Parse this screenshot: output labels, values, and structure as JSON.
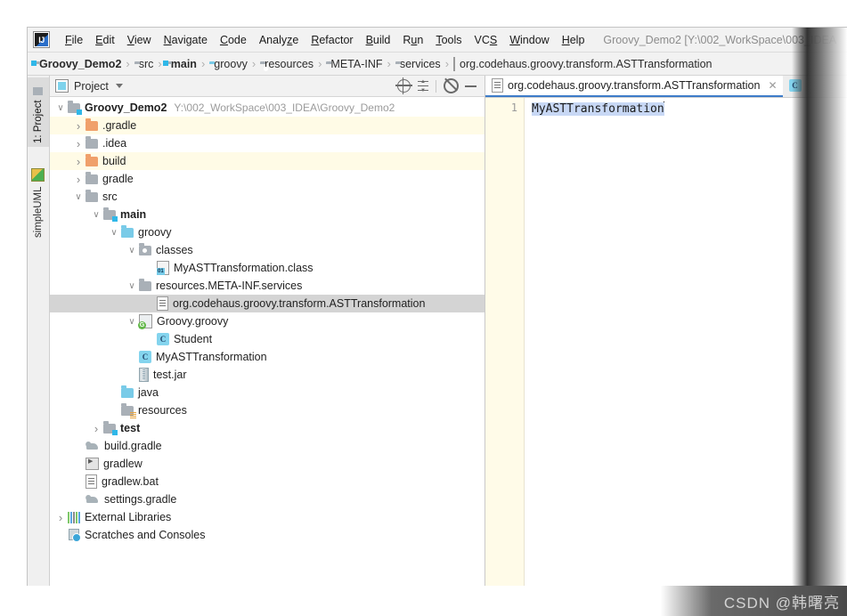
{
  "window": {
    "logo_icon": "intellij-logo-icon",
    "title": "Groovy_Demo2 [Y:\\002_WorkSpace\\003_IDEA"
  },
  "menubar": {
    "items": [
      {
        "pre": "",
        "mn": "F",
        "post": "ile"
      },
      {
        "pre": "",
        "mn": "E",
        "post": "dit"
      },
      {
        "pre": "",
        "mn": "V",
        "post": "iew"
      },
      {
        "pre": "",
        "mn": "N",
        "post": "avigate"
      },
      {
        "pre": "",
        "mn": "C",
        "post": "ode"
      },
      {
        "pre": "Analy",
        "mn": "z",
        "post": "e"
      },
      {
        "pre": "",
        "mn": "R",
        "post": "efactor"
      },
      {
        "pre": "",
        "mn": "B",
        "post": "uild"
      },
      {
        "pre": "R",
        "mn": "u",
        "post": "n"
      },
      {
        "pre": "",
        "mn": "T",
        "post": "ools"
      },
      {
        "pre": "VC",
        "mn": "S",
        "post": ""
      },
      {
        "pre": "",
        "mn": "W",
        "post": "indow"
      },
      {
        "pre": "",
        "mn": "H",
        "post": "elp"
      }
    ]
  },
  "breadcrumb": {
    "items": [
      {
        "label": "Groovy_Demo2",
        "icon": "module-folder-icon",
        "bold": true
      },
      {
        "label": "src",
        "icon": "folder-icon",
        "bold": false
      },
      {
        "label": "main",
        "icon": "module-folder-icon",
        "bold": true
      },
      {
        "label": "groovy",
        "icon": "source-folder-icon",
        "bold": false
      },
      {
        "label": "resources",
        "icon": "resource-folder-icon",
        "bold": false
      },
      {
        "label": "META-INF",
        "icon": "folder-icon",
        "bold": false
      },
      {
        "label": "services",
        "icon": "folder-icon",
        "bold": false
      },
      {
        "label": "org.codehaus.groovy.transform.ASTTransformation",
        "icon": "file-icon",
        "bold": false
      }
    ],
    "separator": "›"
  },
  "toolstrip": {
    "tabs": [
      {
        "label": "1: Project",
        "icon": "project-folder-icon",
        "active": true
      },
      {
        "label": "simpleUML",
        "icon": "uml-icon",
        "active": false
      }
    ]
  },
  "project_panel": {
    "title": "Project",
    "icon": "project-view-icon",
    "dropdown_icon": "chevron-down-icon",
    "actions": [
      {
        "name": "locate-icon",
        "title": "Select Opened File"
      },
      {
        "name": "collapse-all-icon",
        "title": "Collapse All"
      },
      {
        "name": "gear-icon",
        "title": "Settings"
      },
      {
        "name": "minimize-icon",
        "title": "Hide"
      }
    ]
  },
  "tree": {
    "rows": [
      {
        "indent": 0,
        "arrow": "down",
        "icon": "module-folder-icon",
        "label": "Groovy_Demo2",
        "bold": true,
        "path": "Y:\\002_WorkSpace\\003_IDEA\\Groovy_Demo2",
        "state": "normal"
      },
      {
        "indent": 1,
        "arrow": "right",
        "icon": "folder-orange-icon",
        "label": ".gradle",
        "bold": false,
        "path": "",
        "state": "ignored"
      },
      {
        "indent": 1,
        "arrow": "right",
        "icon": "folder-icon",
        "label": ".idea",
        "bold": false,
        "path": "",
        "state": "normal"
      },
      {
        "indent": 1,
        "arrow": "right",
        "icon": "folder-orange-icon",
        "label": "build",
        "bold": false,
        "path": "",
        "state": "ignored"
      },
      {
        "indent": 1,
        "arrow": "right",
        "icon": "folder-icon",
        "label": "gradle",
        "bold": false,
        "path": "",
        "state": "normal"
      },
      {
        "indent": 1,
        "arrow": "down",
        "icon": "folder-icon",
        "label": "src",
        "bold": false,
        "path": "",
        "state": "normal"
      },
      {
        "indent": 2,
        "arrow": "down",
        "icon": "module-folder-icon",
        "label": "main",
        "bold": true,
        "path": "",
        "state": "normal"
      },
      {
        "indent": 3,
        "arrow": "down",
        "icon": "source-folder-icon",
        "label": "groovy",
        "bold": false,
        "path": "",
        "state": "normal"
      },
      {
        "indent": 4,
        "arrow": "down",
        "icon": "excluded-folder-icon",
        "label": "classes",
        "bold": false,
        "path": "",
        "state": "normal"
      },
      {
        "indent": 5,
        "arrow": "none",
        "icon": "class-file-icon",
        "label": "MyASTTransformation.class",
        "bold": false,
        "path": "",
        "state": "normal"
      },
      {
        "indent": 4,
        "arrow": "down",
        "icon": "folder-icon",
        "label": "resources.META-INF.services",
        "bold": false,
        "path": "",
        "state": "normal"
      },
      {
        "indent": 5,
        "arrow": "none",
        "icon": "file-icon",
        "label": "org.codehaus.groovy.transform.ASTTransformation",
        "bold": false,
        "path": "",
        "state": "selected"
      },
      {
        "indent": 4,
        "arrow": "down",
        "icon": "groovy-file-icon",
        "label": "Groovy.groovy",
        "bold": false,
        "path": "",
        "state": "normal"
      },
      {
        "indent": 5,
        "arrow": "none",
        "icon": "class-icon",
        "label": "Student",
        "bold": false,
        "path": "",
        "state": "normal"
      },
      {
        "indent": 4,
        "arrow": "none",
        "icon": "class-icon",
        "label": "MyASTTransformation",
        "bold": false,
        "path": "",
        "state": "normal"
      },
      {
        "indent": 4,
        "arrow": "none",
        "icon": "jar-icon",
        "label": "test.jar",
        "bold": false,
        "path": "",
        "state": "normal"
      },
      {
        "indent": 3,
        "arrow": "none",
        "icon": "source-folder-icon",
        "label": "java",
        "bold": false,
        "path": "",
        "state": "normal"
      },
      {
        "indent": 3,
        "arrow": "none",
        "icon": "resource-folder-icon",
        "label": "resources",
        "bold": false,
        "path": "",
        "state": "normal"
      },
      {
        "indent": 2,
        "arrow": "right",
        "icon": "module-folder-icon",
        "label": "test",
        "bold": true,
        "path": "",
        "state": "normal"
      },
      {
        "indent": 1,
        "arrow": "none",
        "icon": "gradle-icon",
        "label": "build.gradle",
        "bold": false,
        "path": "",
        "state": "normal"
      },
      {
        "indent": 1,
        "arrow": "none",
        "icon": "shell-icon",
        "label": "gradlew",
        "bold": false,
        "path": "",
        "state": "normal"
      },
      {
        "indent": 1,
        "arrow": "none",
        "icon": "file-icon",
        "label": "gradlew.bat",
        "bold": false,
        "path": "",
        "state": "normal"
      },
      {
        "indent": 1,
        "arrow": "none",
        "icon": "gradle-icon",
        "label": "settings.gradle",
        "bold": false,
        "path": "",
        "state": "normal"
      },
      {
        "indent": 0,
        "arrow": "right",
        "icon": "external-libraries-icon",
        "label": "External Libraries",
        "bold": false,
        "path": "",
        "state": "normal"
      },
      {
        "indent": 0,
        "arrow": "none",
        "icon": "scratches-icon",
        "label": "Scratches and Consoles",
        "bold": false,
        "path": "",
        "state": "normal"
      }
    ]
  },
  "editor": {
    "tabs": [
      {
        "label": "org.codehaus.groovy.transform.ASTTransformation",
        "icon": "file-icon",
        "active": true,
        "close_icon": "close-icon"
      },
      {
        "label": "C",
        "icon": "class-icon",
        "active": false,
        "close_icon": ""
      }
    ],
    "gutter": {
      "lines": [
        "1"
      ]
    },
    "content": {
      "line1_selected_text": "MyASTTransformation"
    }
  },
  "watermark": {
    "text": "CSDN @韩曙亮"
  },
  "colors": {
    "accent": "#3d7cc9",
    "selection_blue": "#c8d8f5",
    "ignored_row": "#fffbe6",
    "selected_row": "#d4d4d4",
    "chrome": "#f2f2f2"
  }
}
